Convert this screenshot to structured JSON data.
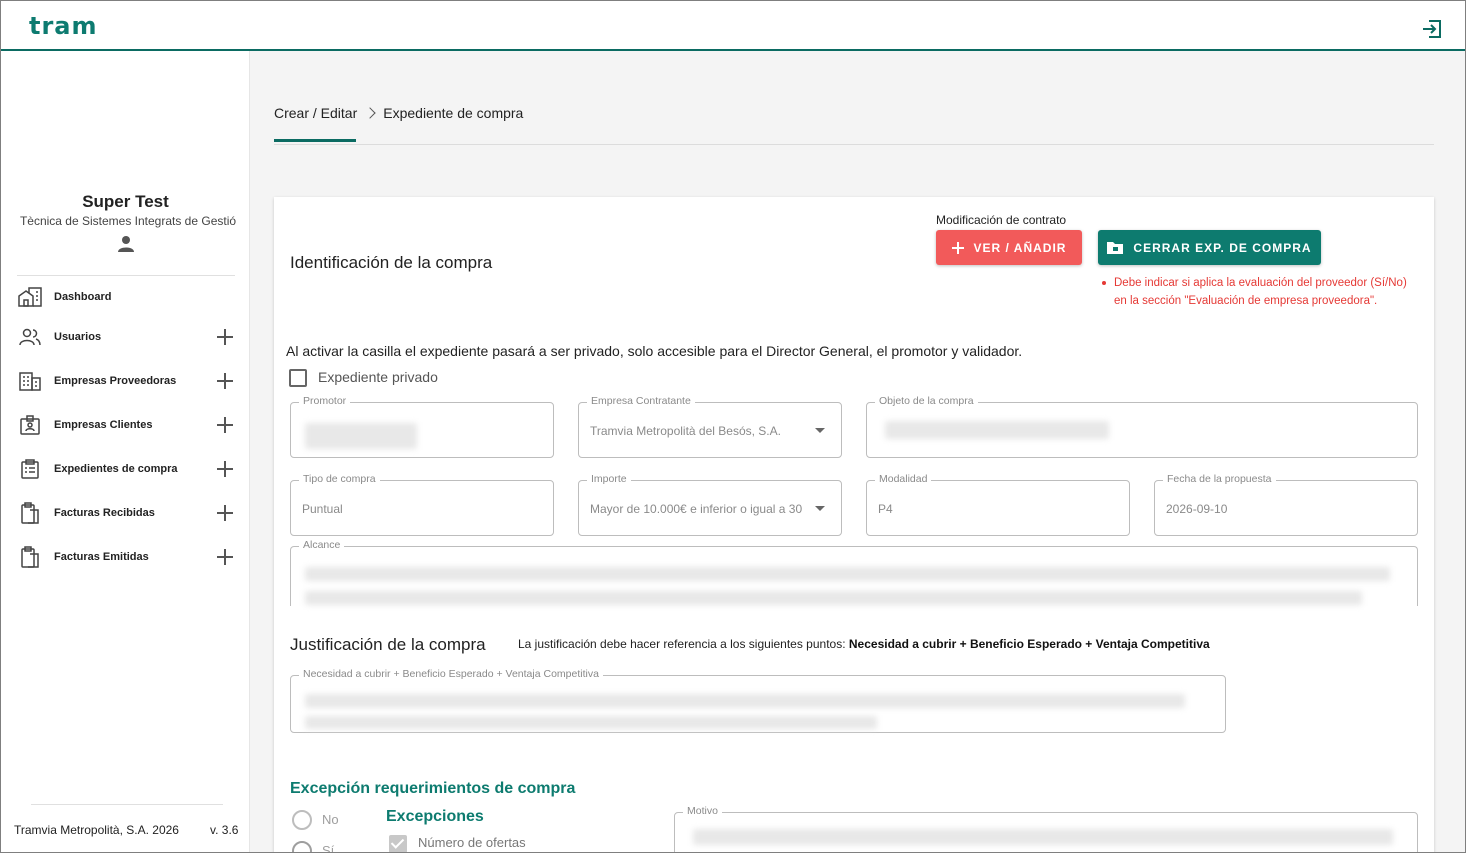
{
  "header": {
    "logo_text": "TRAM",
    "logout_icon": "logout-icon"
  },
  "sidebar": {
    "user_name": "Super Test",
    "user_org": "Tècnica de Sistemes Integrats de Gestió",
    "user_icon": "person-icon",
    "items": [
      {
        "label": "Dashboard",
        "icon": "dashboard-building-icon",
        "expandable": false
      },
      {
        "label": "Usuarios",
        "icon": "users-icon",
        "expandable": true
      },
      {
        "label": "Empresas Proveedoras",
        "icon": "company-building-icon",
        "expandable": true
      },
      {
        "label": "Empresas Clientes",
        "icon": "badge-icon",
        "expandable": true
      },
      {
        "label": "Expedientes de compra",
        "icon": "clipboard-list-icon",
        "expandable": true
      },
      {
        "label": "Facturas Recibidas",
        "icon": "invoice-icon",
        "expandable": true
      },
      {
        "label": "Facturas Emitidas",
        "icon": "invoice-icon",
        "expandable": true
      }
    ],
    "footer": {
      "company": "Tramvia Metropolità, S.A. 2026",
      "version": "v. 3.6"
    }
  },
  "breadcrumb": {
    "first": "Crear / Editar",
    "second": "Expediente de compra"
  },
  "form": {
    "section_identification": "Identificación de la compra",
    "modification_label": "Modificación de contrato",
    "btn_view_add": "VER / AÑADIR",
    "btn_close": "CERRAR EXP. DE COMPRA",
    "error_message": "Debe indicar si aplica la evaluación del proveedor (Sí/No) en la sección \"Evaluación de empresa proveedora\".",
    "private_text": "Al activar la casilla el expediente pasará a ser privado, solo accesible para el Director General, el promotor y validador.",
    "private_checkbox_label": "Expediente privado",
    "fields": {
      "promotor": {
        "label": "Promotor",
        "value": ""
      },
      "empresa": {
        "label": "Empresa Contratante",
        "value": "Tramvia Metropolità del Besós, S.A."
      },
      "objeto": {
        "label": "Objeto de la compra",
        "value": ""
      },
      "tipo": {
        "label": "Tipo de compra",
        "value": "Puntual"
      },
      "importe": {
        "label": "Importe",
        "value": "Mayor de 10.000€ e inferior o igual a 30"
      },
      "modalidad": {
        "label": "Modalidad",
        "value": "P4"
      },
      "fecha": {
        "label": "Fecha de la propuesta",
        "value": "2026-09-10"
      },
      "alcance": {
        "label": "Alcance",
        "value": ""
      }
    },
    "section_justification": "Justificación de la compra",
    "justification_note_prefix": "La justificación debe hacer referencia a los siguientes puntos:",
    "justification_note_bold": "Necesidad a cubrir + Beneficio Esperado + Ventaja Competitiva",
    "justification_field_label": "Necesidad a cubrir + Beneficio Esperado + Ventaja Competitiva",
    "exception_title": "Excepción requerimientos de compra",
    "radio_no": "No",
    "radio_si": "Sí",
    "exceptions_title": "Excepciones",
    "exception_option": "Número de ofertas",
    "motivo_label": "Motivo"
  }
}
